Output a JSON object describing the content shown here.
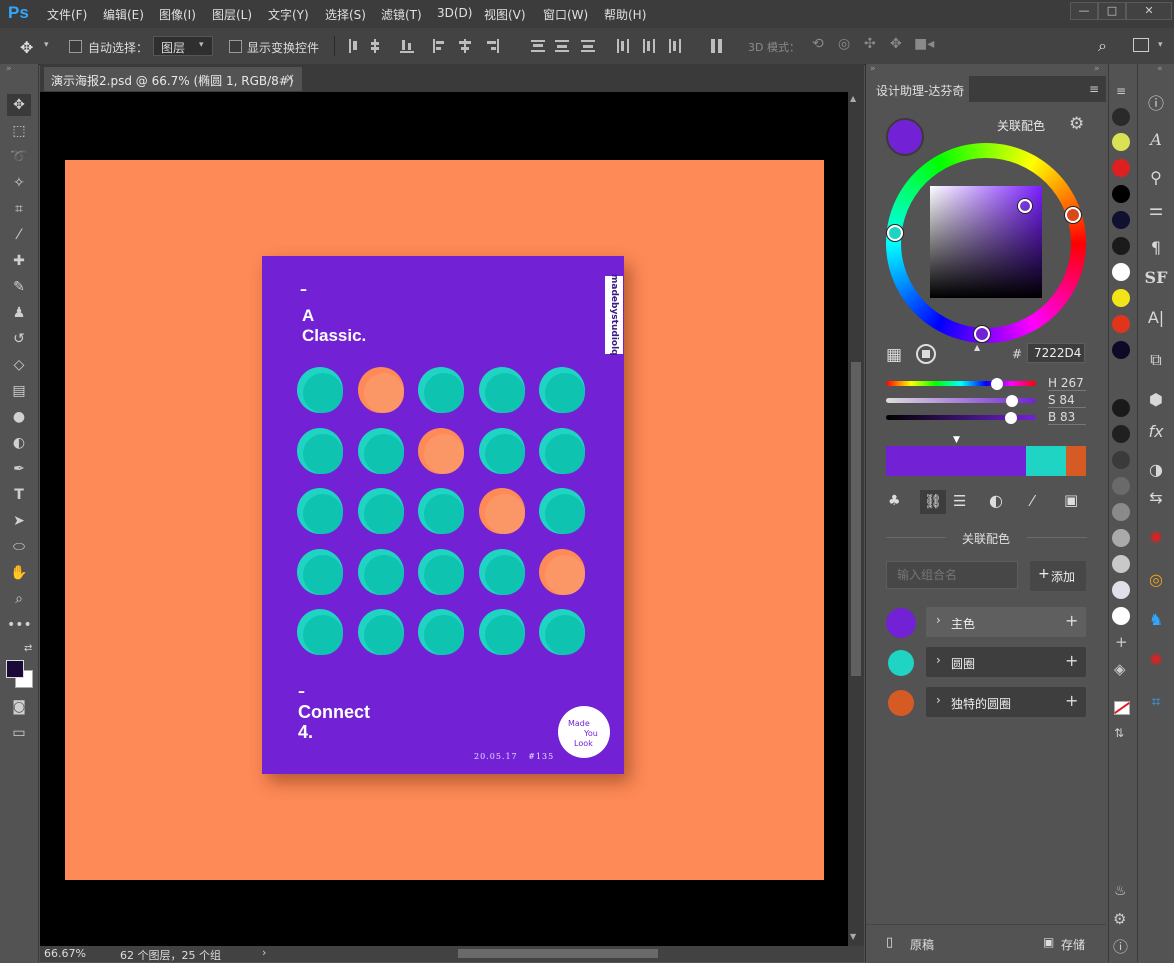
{
  "app": {
    "logo": "Ps"
  },
  "menu": [
    "文件(F)",
    "编辑(E)",
    "图像(I)",
    "图层(L)",
    "文字(Y)",
    "选择(S)",
    "滤镜(T)",
    "3D(D)",
    "视图(V)",
    "窗口(W)",
    "帮助(H)"
  ],
  "window_controls": {
    "minimize": "—",
    "maximize": "□",
    "close": "✕"
  },
  "options": {
    "auto_select_label": "自动选择：",
    "auto_select_value": "图层",
    "show_transform_label": "显示变换控件",
    "mode_3d_label": "3D 模式："
  },
  "document": {
    "tab_title": "演示海报2.psd @ 66.7% (椭圆 1, RGB/8#)",
    "close": "×"
  },
  "status": {
    "zoom": "66.67%",
    "info": "62 个图层，25 个组",
    "arrow": "›"
  },
  "poster": {
    "title_dash": "–",
    "title_line1": "A",
    "title_line2": "Classic.",
    "side_tag": "madebystudiolq",
    "footer_dash": "–",
    "footer_line1": "Connect",
    "footer_line2": "4.",
    "badge_line1": "Made",
    "badge_line2": "You",
    "badge_line3": "Look",
    "date": "20.05.17   #135",
    "grid": [
      [
        "teal",
        "orange",
        "teal",
        "teal",
        "teal"
      ],
      [
        "teal",
        "teal",
        "orange",
        "teal",
        "teal"
      ],
      [
        "teal",
        "teal",
        "teal",
        "orange",
        "teal"
      ],
      [
        "teal",
        "teal",
        "teal",
        "teal",
        "orange"
      ],
      [
        "teal",
        "teal",
        "teal",
        "teal",
        "teal"
      ]
    ]
  },
  "panel": {
    "tab_title": "设计助理-达芬奇",
    "related_colors_label": "关联配色",
    "hex_prefix": "#",
    "hex_value": "7222D4",
    "h_label": "H 267",
    "s_label": "S 84",
    "b_label": "B 83",
    "h_value": 267,
    "s_value": 84,
    "b_value": 83,
    "section_title": "关联配色",
    "group_placeholder": "输入组合名",
    "add_button": "添加",
    "add_plus": "+",
    "rows": [
      {
        "label": "主色",
        "color": "#7222d4"
      },
      {
        "label": "圆圈",
        "color": "#1fd4c2"
      },
      {
        "label": "独特的圆圈",
        "color": "#d65a24"
      }
    ],
    "footer_left": "原稿",
    "footer_right": "存储"
  },
  "colors": {
    "primary": "#7222d4",
    "teal": "#1fd4c2",
    "orange": "#fe8a57",
    "accent_orange": "#d65a24"
  },
  "swatches": [
    "#2a2a2a",
    "#d9e155",
    "#e02020",
    "#000000",
    "#101030",
    "#1a1a1a",
    "#ffffff",
    "#f2e41a",
    "#e0341c",
    "#0c0a24",
    "#1a1a1a",
    "#202020",
    "#3a3a3a",
    "#6a6a6a",
    "#8a8a8a",
    "#aaaaaa",
    "#c8c8c8",
    "#e0e0ea",
    "#ffffff"
  ]
}
